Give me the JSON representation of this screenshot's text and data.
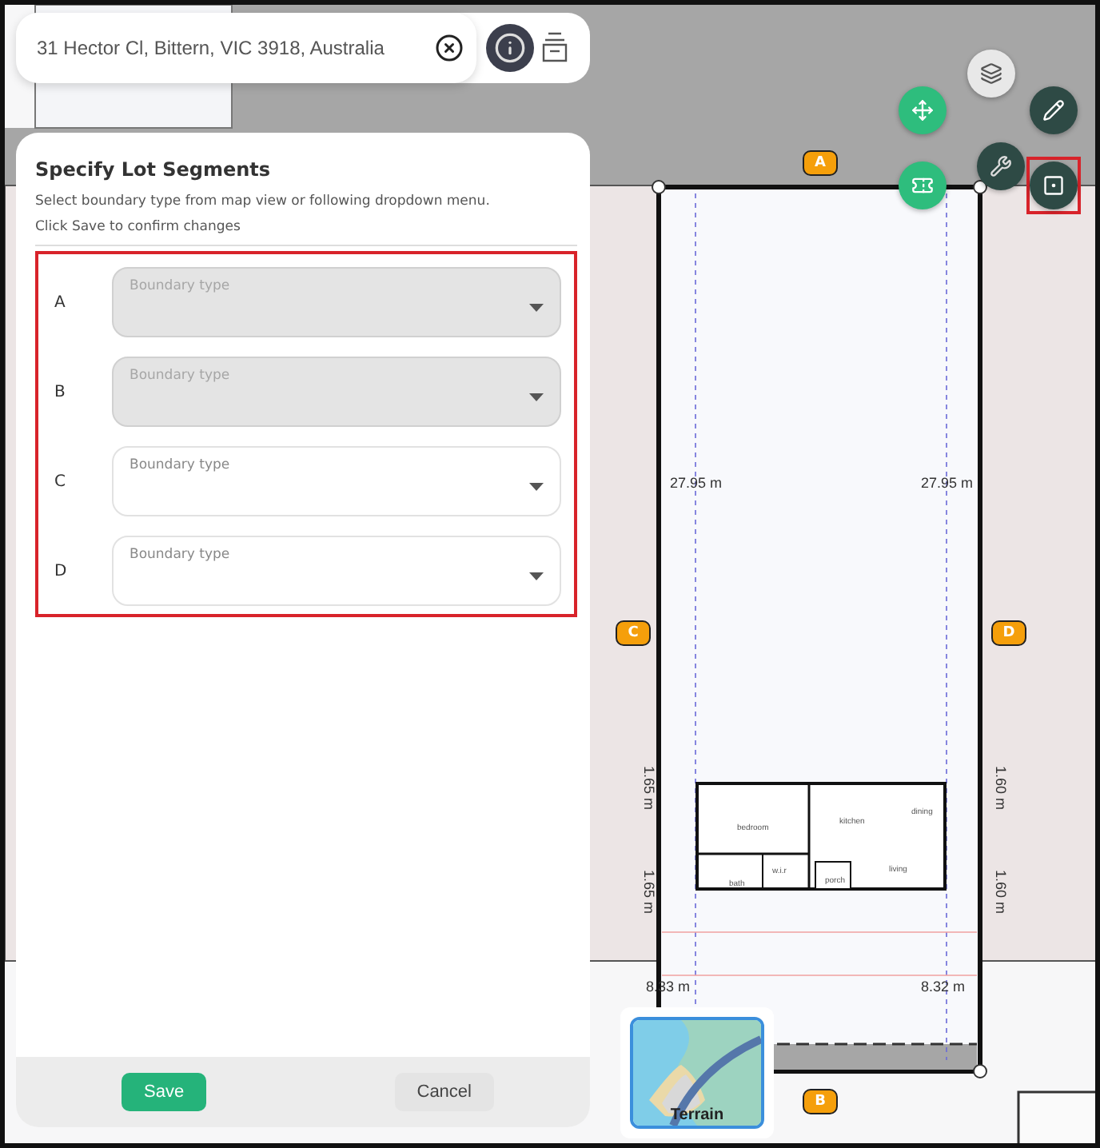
{
  "search": {
    "value": "31 Hector Cl, Bittern, VIC 3918, Australia",
    "info_active": true
  },
  "panel": {
    "title": "Specify Lot Segments",
    "instructions": [
      "Select boundary type from map view or following dropdown menu.",
      "Click Save to confirm changes"
    ],
    "highlighted": true,
    "segments": [
      {
        "label": "A",
        "placeholder": "Boundary type",
        "disabled": true
      },
      {
        "label": "B",
        "placeholder": "Boundary type",
        "disabled": true
      },
      {
        "label": "C",
        "placeholder": "Boundary type",
        "disabled": false
      },
      {
        "label": "D",
        "placeholder": "Boundary type",
        "disabled": false
      }
    ],
    "buttons": [
      {
        "kind": "primary",
        "label": "Save"
      },
      {
        "kind": "secondary",
        "label": "Cancel"
      }
    ]
  },
  "map": {
    "badges": [
      "A",
      "B",
      "C",
      "D"
    ],
    "measurements": [
      {
        "kind": "horizontal",
        "text": "27.95 m"
      },
      {
        "kind": "horizontal",
        "text": "27.95 m"
      },
      {
        "kind": "vertical",
        "text": "1.65 m"
      },
      {
        "kind": "vertical",
        "text": "1.65 m"
      },
      {
        "kind": "vertical",
        "text": "1.60 m"
      },
      {
        "kind": "vertical",
        "text": "1.60 m"
      },
      {
        "kind": "horizontal",
        "text": "8.33 m"
      },
      {
        "kind": "horizontal",
        "text": "8.32 m"
      }
    ],
    "rooms": [
      "bedroom",
      "kitchen",
      "dining",
      "bath",
      "w.i.r",
      "porch",
      "living"
    ],
    "tools": [
      {
        "kind": "layers",
        "highlighted": false
      },
      {
        "kind": "move",
        "highlighted": false
      },
      {
        "kind": "edit",
        "highlighted": false
      },
      {
        "kind": "ticket",
        "highlighted": false
      },
      {
        "kind": "wrench",
        "highlighted": false
      },
      {
        "kind": "segment",
        "highlighted": true
      }
    ],
    "terrain": {
      "label": "Terrain"
    }
  }
}
